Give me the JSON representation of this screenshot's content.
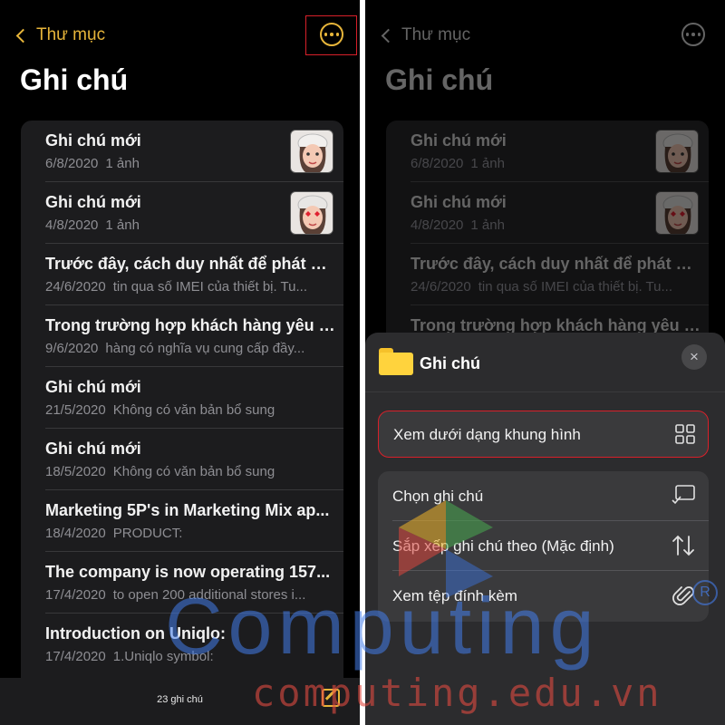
{
  "nav": {
    "back_label": "Thư mục"
  },
  "page_title": "Ghi chú",
  "notes": [
    {
      "title": "Ghi chú mới",
      "date": "6/8/2020",
      "preview": "1 ảnh",
      "thumb": "memoji-white-hat"
    },
    {
      "title": "Ghi chú mới",
      "date": "4/8/2020",
      "preview": "1 ảnh",
      "thumb": "memoji-heart-eyes"
    },
    {
      "title": "Trước đây, cách duy nhất để phát hi...",
      "date": "24/6/2020",
      "preview": "tin qua số IMEI của thiết bị. Tu..."
    },
    {
      "title": "Trong trường hợp khách hàng yêu c...",
      "date": "9/6/2020",
      "preview": "hàng có nghĩa vụ cung cấp đầy..."
    },
    {
      "title": "Ghi chú mới",
      "date": "21/5/2020",
      "preview": "Không có văn bản bổ sung"
    },
    {
      "title": "Ghi chú mới",
      "date": "18/5/2020",
      "preview": "Không có văn bản bổ sung"
    },
    {
      "title": "Marketing 5P's in Marketing Mix ap...",
      "date": "18/4/2020",
      "preview": "PRODUCT:"
    },
    {
      "title": "The company is now operating 157...",
      "date": "17/4/2020",
      "preview": "to open 200 additional stores i..."
    },
    {
      "title": "Introduction on Uniqlo:",
      "date": "17/4/2020",
      "preview": "1.Uniqlo symbol:"
    }
  ],
  "bottom_bar": {
    "count": "23 ghi chú"
  },
  "sheet": {
    "title": "Ghi chú",
    "close_icon": "×",
    "view_gallery_label": "Xem dưới dạng khung hình",
    "items": [
      {
        "label": "Chọn ghi chú",
        "icon": "select-icon"
      },
      {
        "label": "Sắp xếp ghi chú theo (Mặc định)",
        "icon": "sort-icon"
      },
      {
        "label": "Xem tệp đính kèm",
        "icon": "paperclip-icon"
      }
    ]
  },
  "watermark": {
    "main": "Computing",
    "sub": "computing.edu.vn",
    "reg": "R"
  },
  "colors": {
    "accent": "#e7b53a",
    "highlight": "#d8202a",
    "background": "#000000",
    "card": "#1c1c1e",
    "sheet": "#2c2c2e"
  }
}
